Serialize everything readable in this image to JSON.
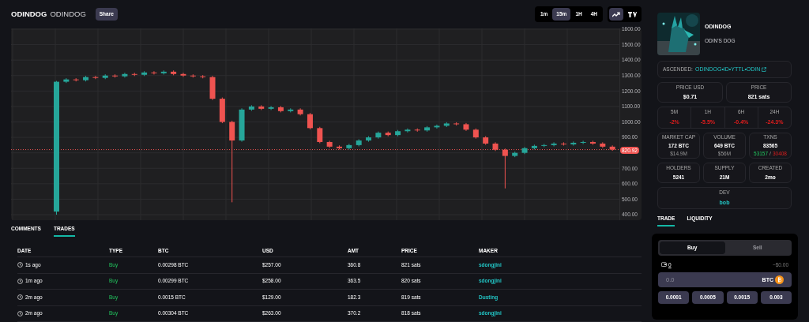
{
  "token": {
    "ticker": "ODINDOG",
    "name": "ODINDOG",
    "share": "Share"
  },
  "timeframes": [
    {
      "label": "1m",
      "selected": false
    },
    {
      "label": "15m",
      "selected": true
    },
    {
      "label": "1H",
      "selected": false
    },
    {
      "label": "4H",
      "selected": false
    }
  ],
  "chart_types": [
    {
      "kind": "line",
      "selected": true
    },
    {
      "kind": "tradingview",
      "selected": false
    }
  ],
  "chart": {
    "chart_data": {
      "type": "candlestick",
      "ylim": [
        400,
        1600
      ],
      "yticks": [
        {
          "value": 1600,
          "label": "1600.00"
        },
        {
          "value": 1500,
          "label": "1500.00"
        },
        {
          "value": 1400,
          "label": "1400.00"
        },
        {
          "value": 1300,
          "label": "1300.00"
        },
        {
          "value": 1200,
          "label": "1200.00"
        },
        {
          "value": 1100,
          "label": "1100.00"
        },
        {
          "value": 1000,
          "label": "1000.00"
        },
        {
          "value": 900,
          "label": "900.00"
        },
        {
          "value": 700,
          "label": "700.00"
        },
        {
          "value": 600,
          "label": "600.00"
        },
        {
          "value": 500,
          "label": "500.00"
        },
        {
          "value": 400,
          "label": "400.00"
        }
      ],
      "grid": true,
      "ref_lines": [
        {
          "axis": "y",
          "value": 820.92,
          "label": "820.92",
          "color": "#ef5350"
        }
      ],
      "ohlc": [
        [
          420,
          1265,
          400,
          1260
        ],
        [
          1260,
          1283,
          1252,
          1275
        ],
        [
          1275,
          1283,
          1262,
          1270
        ],
        [
          1270,
          1298,
          1262,
          1290
        ],
        [
          1290,
          1298,
          1277,
          1285
        ],
        [
          1285,
          1308,
          1277,
          1300
        ],
        [
          1300,
          1308,
          1287,
          1295
        ],
        [
          1295,
          1318,
          1287,
          1310
        ],
        [
          1310,
          1318,
          1297,
          1305
        ],
        [
          1305,
          1328,
          1297,
          1320
        ],
        [
          1320,
          1328,
          1307,
          1315
        ],
        [
          1315,
          1333,
          1307,
          1325
        ],
        [
          1325,
          1333,
          1302,
          1310
        ],
        [
          1310,
          1318,
          1292,
          1300
        ],
        [
          1300,
          1308,
          1287,
          1295
        ],
        [
          1295,
          1303,
          1282,
          1290
        ],
        [
          1290,
          1298,
          1142,
          1150
        ],
        [
          1150,
          1158,
          992,
          1000
        ],
        [
          1000,
          1008,
          480,
          880
        ],
        [
          880,
          1088,
          872,
          1080
        ],
        [
          1080,
          1108,
          1072,
          1100
        ],
        [
          1100,
          1108,
          1077,
          1085
        ],
        [
          1085,
          1103,
          1077,
          1095
        ],
        [
          1095,
          1103,
          1062,
          1070
        ],
        [
          1070,
          1088,
          1062,
          1080
        ],
        [
          1080,
          1088,
          1042,
          1050
        ],
        [
          1050,
          1058,
          952,
          960
        ],
        [
          960,
          968,
          862,
          870
        ],
        [
          870,
          878,
          832,
          840
        ],
        [
          840,
          848,
          822,
          830
        ],
        [
          830,
          858,
          822,
          850
        ],
        [
          850,
          888,
          842,
          880
        ],
        [
          880,
          908,
          872,
          900
        ],
        [
          900,
          938,
          892,
          930
        ],
        [
          930,
          938,
          907,
          915
        ],
        [
          915,
          948,
          907,
          940
        ],
        [
          940,
          958,
          932,
          950
        ],
        [
          950,
          958,
          937,
          945
        ],
        [
          945,
          973,
          937,
          965
        ],
        [
          965,
          983,
          957,
          975
        ],
        [
          975,
          998,
          967,
          990
        ],
        [
          990,
          998,
          977,
          985
        ],
        [
          985,
          993,
          942,
          950
        ],
        [
          950,
          958,
          892,
          900
        ],
        [
          900,
          908,
          852,
          860
        ],
        [
          860,
          868,
          812,
          820
        ],
        [
          820,
          828,
          570,
          780
        ],
        [
          780,
          808,
          772,
          800
        ],
        [
          800,
          838,
          792,
          830
        ],
        [
          830,
          853,
          822,
          845
        ],
        [
          845,
          858,
          837,
          850
        ],
        [
          850,
          868,
          842,
          860
        ],
        [
          860,
          868,
          847,
          855
        ],
        [
          855,
          873,
          847,
          865
        ],
        [
          865,
          878,
          857,
          870
        ],
        [
          870,
          878,
          852,
          860
        ],
        [
          860,
          868,
          832,
          840
        ],
        [
          840,
          848,
          813,
          821
        ]
      ]
    }
  },
  "bottom_tabs": [
    {
      "label": "COMMENTS",
      "selected": false
    },
    {
      "label": "TRADES",
      "selected": true
    }
  ],
  "trades": {
    "columns": [
      "DATE",
      "TYPE",
      "BTC",
      "USD",
      "AMT",
      "PRICE",
      "MAKER"
    ],
    "rows": [
      {
        "date": "1s ago",
        "type": "Buy",
        "btc": "0.00298 BTC",
        "usd": "$257.00",
        "amt": "360.8",
        "price": "821 sats",
        "maker": "sdongjini"
      },
      {
        "date": "1m ago",
        "type": "Buy",
        "btc": "0.00299 BTC",
        "usd": "$258.00",
        "amt": "363.5",
        "price": "820 sats",
        "maker": "sdongjini"
      },
      {
        "date": "2m ago",
        "type": "Buy",
        "btc": "0.0015 BTC",
        "usd": "$129.00",
        "amt": "182.3",
        "price": "819 sats",
        "maker": "Dusting"
      },
      {
        "date": "2m ago",
        "type": "Buy",
        "btc": "0.00304 BTC",
        "usd": "$263.00",
        "amt": "370.2",
        "price": "818 sats",
        "maker": "sdongjini"
      }
    ]
  },
  "sidebar": {
    "title": "ODINDOG",
    "subtitle": "ODIN'S DOG",
    "ascended": {
      "label": "ASCENDED:",
      "link": "ODINDOG•ID•YTTL•ODIN"
    },
    "price": [
      {
        "label": "PRICE USD",
        "value": "$0.71"
      },
      {
        "label": "PRICE",
        "value": "821 sats"
      }
    ],
    "changes": [
      {
        "label": "5M",
        "value": "-2%"
      },
      {
        "label": "1H",
        "value": "-5.5%"
      },
      {
        "label": "6H",
        "value": "-0.4%"
      },
      {
        "label": "24H",
        "value": "-24.3%"
      }
    ],
    "stats": [
      {
        "label": "MARKET CAP",
        "value": "172 BTC",
        "sub": "$14.9M"
      },
      {
        "label": "VOLUME",
        "value": "649 BTC",
        "sub": "$56M"
      },
      {
        "label": "TXNS",
        "value": "83565",
        "buys": "53157",
        "sep": "/",
        "sells": "30408"
      }
    ],
    "stats2": [
      {
        "label": "HOLDERS",
        "value": "5241"
      },
      {
        "label": "SUPPLY",
        "value": "21M"
      },
      {
        "label": "CREATED",
        "value": "2mo"
      }
    ],
    "dev": {
      "label": "DEV",
      "value": "bob"
    }
  },
  "trade_tabs": [
    {
      "label": "TRADE",
      "selected": true
    },
    {
      "label": "LIQUIDITY",
      "selected": false
    }
  ],
  "trade": {
    "sides": [
      {
        "label": "Buy",
        "selected": true
      },
      {
        "label": "Sell",
        "selected": false
      }
    ],
    "balance": "0",
    "usd_value": "~$0.00",
    "amount_placeholder": "0.0",
    "currency": "BTC",
    "presets": [
      "0.0001",
      "0.0005",
      "0.0015",
      "0.003"
    ]
  }
}
